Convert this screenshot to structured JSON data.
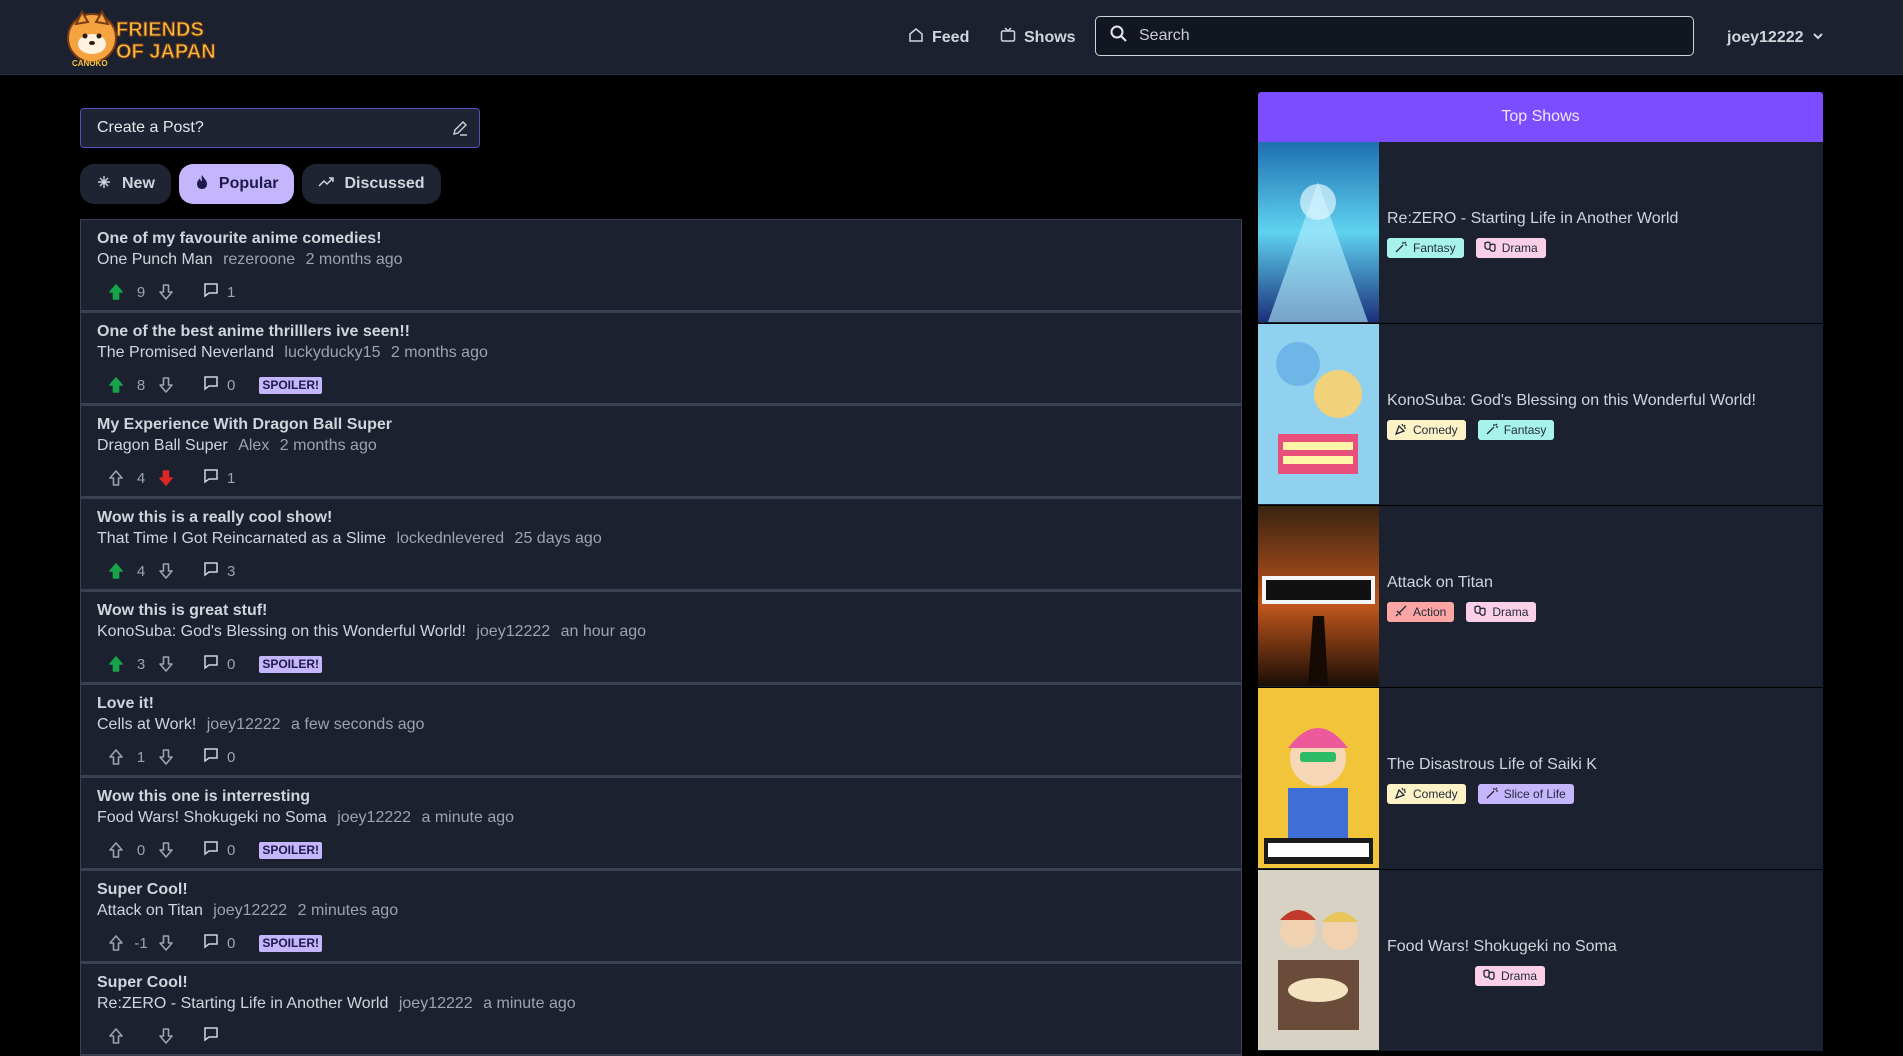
{
  "header": {
    "logo_text_line1": "FRIENDS",
    "logo_text_line2": "OF JAPAN",
    "logo_subtext": "CANOKO",
    "nav_feed": "Feed",
    "nav_shows": "Shows",
    "search_placeholder": "Search",
    "username": "joey12222"
  },
  "create_post": {
    "placeholder": "Create a Post?"
  },
  "sort_tabs": [
    {
      "label": "New",
      "active": false
    },
    {
      "label": "Popular",
      "active": true
    },
    {
      "label": "Discussed",
      "active": false
    }
  ],
  "posts": [
    {
      "title": "One of my favourite anime comedies!",
      "show": "One Punch Man",
      "author": "rezeroone",
      "time": "2 months ago",
      "score": "9",
      "comments": "1",
      "vote": "up",
      "spoiler": ""
    },
    {
      "title": "One of the best anime thrilllers ive seen!!",
      "show": "The Promised Neverland",
      "author": "luckyducky15",
      "time": "2 months ago",
      "score": "8",
      "comments": "0",
      "vote": "up",
      "spoiler": "SPOILER!"
    },
    {
      "title": "My Experience With Dragon Ball Super",
      "show": "Dragon Ball Super",
      "author": "Alex",
      "time": "2 months ago",
      "score": "4",
      "comments": "1",
      "vote": "down",
      "spoiler": ""
    },
    {
      "title": "Wow this is a really cool show!",
      "show": "That Time I Got Reincarnated as a Slime",
      "author": "lockednlevered",
      "time": "25 days ago",
      "score": "4",
      "comments": "3",
      "vote": "up",
      "spoiler": ""
    },
    {
      "title": "Wow this is great stuf!",
      "show": "KonoSuba: God's Blessing on this Wonderful World!",
      "author": "joey12222",
      "time": "an hour ago",
      "score": "3",
      "comments": "0",
      "vote": "up",
      "spoiler": "SPOILER!"
    },
    {
      "title": "Love it!",
      "show": "Cells at Work!",
      "author": "joey12222",
      "time": "a few seconds ago",
      "score": "1",
      "comments": "0",
      "vote": "none",
      "spoiler": ""
    },
    {
      "title": "Wow this one is interresting",
      "show": "Food Wars! Shokugeki no Soma",
      "author": "joey12222",
      "time": "a minute ago",
      "score": "0",
      "comments": "0",
      "vote": "none",
      "spoiler": "SPOILER!"
    },
    {
      "title": "Super Cool!",
      "show": "Attack on Titan",
      "author": "joey12222",
      "time": "2 minutes ago",
      "score": "-1",
      "comments": "0",
      "vote": "none",
      "spoiler": "SPOILER!"
    },
    {
      "title": "Super Cool!",
      "show": "Re:ZERO - Starting Life in Another World",
      "author": "joey12222",
      "time": "a minute ago",
      "score": "",
      "comments": "",
      "vote": "none",
      "spoiler": ""
    }
  ],
  "top_shows": {
    "heading": "Top Shows",
    "shows": [
      {
        "name": "Re:ZERO - Starting Life in Another World",
        "tags": [
          "Fantasy",
          "Drama"
        ]
      },
      {
        "name": "KonoSuba: God's Blessing on this Wonderful World!",
        "tags": [
          "Comedy",
          "Fantasy"
        ]
      },
      {
        "name": "Attack on Titan",
        "tags": [
          "Action",
          "Drama"
        ]
      },
      {
        "name": "The Disastrous Life of Saiki K",
        "tags": [
          "Comedy",
          "Slice of Life"
        ]
      },
      {
        "name": "Food Wars! Shokugeki no Soma",
        "tags": [
          "Drama"
        ]
      }
    ]
  },
  "colors": {
    "accent": "#7c4dff",
    "upvote": "#16a34a",
    "downvote": "#dc2626",
    "spoiler_bg": "#c4b5fd"
  }
}
